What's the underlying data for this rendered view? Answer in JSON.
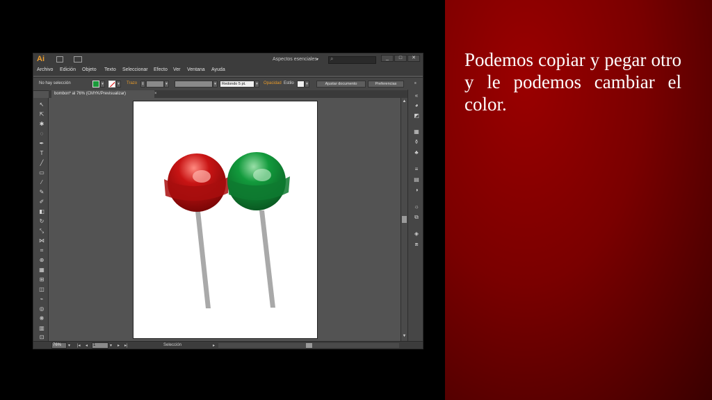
{
  "slide": {
    "text": "Podemos copiar y pegar otro y le podemos cambiar el color."
  },
  "app": {
    "logo": "Ai",
    "workspace": "Aspectos esenciales",
    "search_placeholder": "",
    "window_buttons": [
      "_",
      "□",
      "✕"
    ]
  },
  "menu": [
    "Archivo",
    "Edición",
    "Objeto",
    "Texto",
    "Seleccionar",
    "Efecto",
    "Ver",
    "Ventana",
    "Ayuda"
  ],
  "controlbar": {
    "selection": "No hay selección",
    "stroke_label": "Trazo",
    "brush": "Redondo 5 pt.",
    "opacity_label": "Opacidad",
    "style_label": "Estilo",
    "adjust_document": "Ajustar documento",
    "preferences": "Preferencias",
    "fill_color": "#1a9a3a"
  },
  "document": {
    "tab_title": "bombon* al 76% (CMYK/Previsualizar)",
    "tab_close": "×"
  },
  "artwork": {
    "lollipops": [
      {
        "name": "red",
        "base": "#c81414",
        "dark": "#7a0606",
        "light": "#ff8a80"
      },
      {
        "name": "green",
        "base": "#129a3c",
        "dark": "#0a5a22",
        "light": "#9adfa8"
      }
    ],
    "stick_color": "#a9a9a9"
  },
  "statusbar": {
    "zoom": "76%",
    "page": "1",
    "tool": "Selección"
  }
}
